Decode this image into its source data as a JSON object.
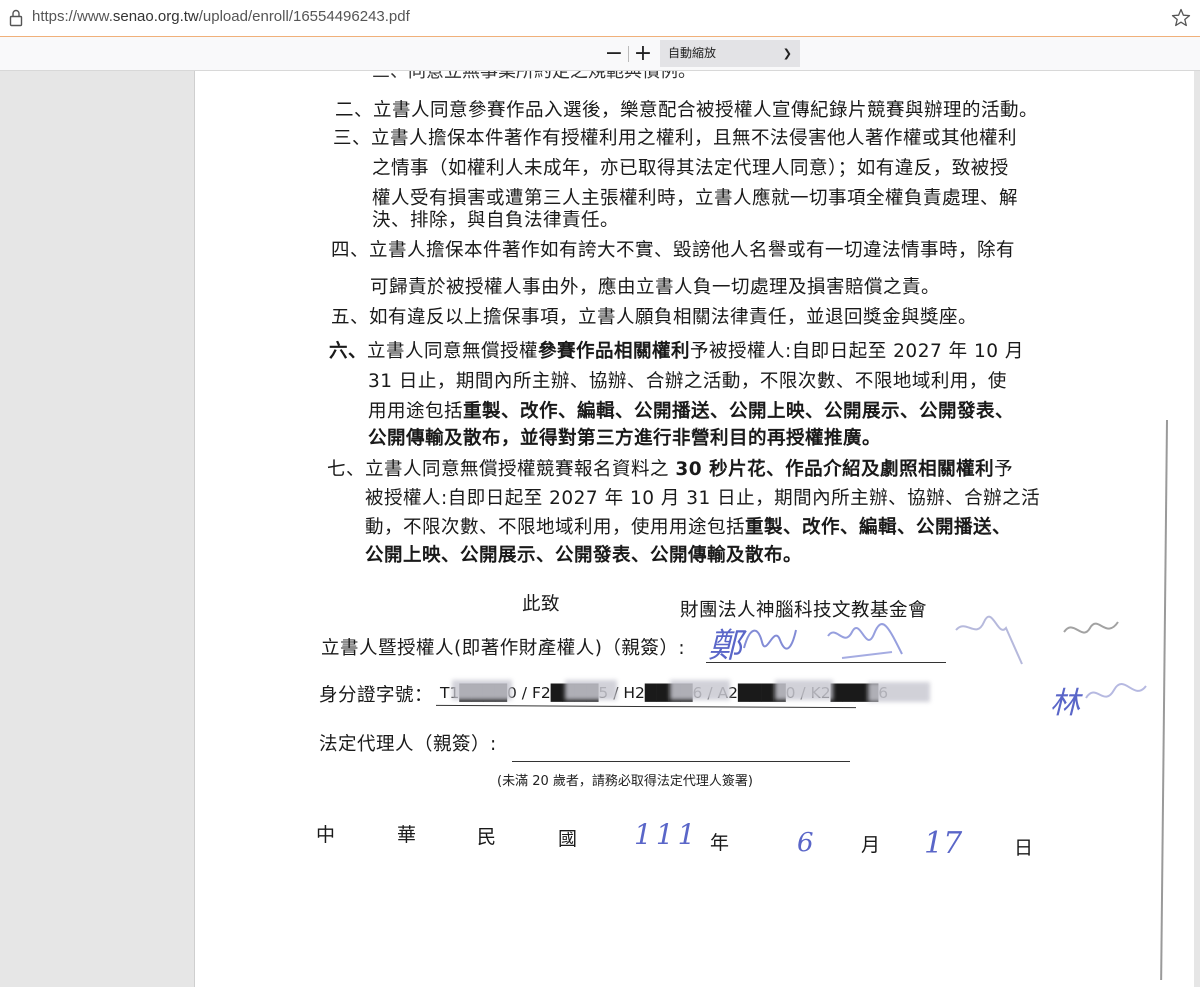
{
  "browser": {
    "url_prefix": "https://www.",
    "url_host": "senao.org.tw",
    "url_path": "/upload/enroll/16554496243.pdf"
  },
  "toolbar": {
    "zoom_out_label": "−",
    "zoom_in_label": "+",
    "zoom_value": "自動縮放"
  },
  "document": {
    "cut_line": "三、同意立無事業所約定之規範與慣例。",
    "lines": [
      "二、立書人同意參賽作品入選後，樂意配合被授權人宣傳紀錄片競賽與辦理的活動。",
      "三、立書人擔保本件著作有授權利用之權利，且無不法侵害他人著作權或其他權利",
      "之情事（如權利人未成年，亦已取得其法定代理人同意）；如有違反，致被授",
      "權人受有損害或遭第三人主張權利時，立書人應就一切事項全權負責處理、解",
      "決、排除，與自負法律責任。",
      "四、立書人擔保本件著作如有誇大不實、毀謗他人名譽或有一切違法情事時，除有",
      "可歸責於被授權人事由外，應由立書人負一切處理及損害賠償之責。",
      "五、如有違反以上擔保事項，立書人願負相關法律責任，並退回獎金與獎座。"
    ],
    "item6": {
      "num": "六、",
      "l1a": "立書人同意無償授權",
      "l1b": "參賽作品相關權利",
      "l1c": "予被授權人:自即日起至 2027 年 10 月",
      "l2": "31 日止，期間內所主辦、協辦、合辦之活動，不限次數、不限地域利用，使",
      "l3a": "用用途包括",
      "l3b": "重製、改作、編輯、公開播送、公開上映、公開展示、公開發表、",
      "l4": "公開傳輸及散布，並得對第三方進行非營利目的再授權推廣。"
    },
    "item7": {
      "l1a": "七、立書人同意無償授權競賽報名資料之 ",
      "l1b": "30 秒片花、作品介紹及劇照相關權利",
      "l1c": "予",
      "l2": "被授權人:自即日起至 2027 年 10 月 31 日止，期間內所主辦、協辦、合辦之活",
      "l3a": "動，不限次數、不限地域利用，使用用途包括",
      "l3b": "重製、改作、編輯、公開播送、",
      "l4": "公開上映、公開展示、公開發表、公開傳輸及散布。"
    },
    "closing": "此致",
    "recipient": "財團法人神腦科技文教基金會",
    "signer_label": "立書人暨授權人(即著作財產權人)（親簽）:",
    "id_label": "身分證字號：",
    "id_values": "T1████0 / F2████5 / H2████6 / A2████0 / K2████6",
    "guardian_label": "法定代理人（親簽）:",
    "guardian_note": "(未滿 20 歲者，請務必取得法定代理人簽署)",
    "date": {
      "era": [
        "中",
        "華",
        "民",
        "國"
      ],
      "year": "111",
      "year_label": "年",
      "month": "6",
      "month_label": "月",
      "day": "17",
      "day_label": "日"
    },
    "signatures": [
      "鄭",
      "林"
    ]
  }
}
